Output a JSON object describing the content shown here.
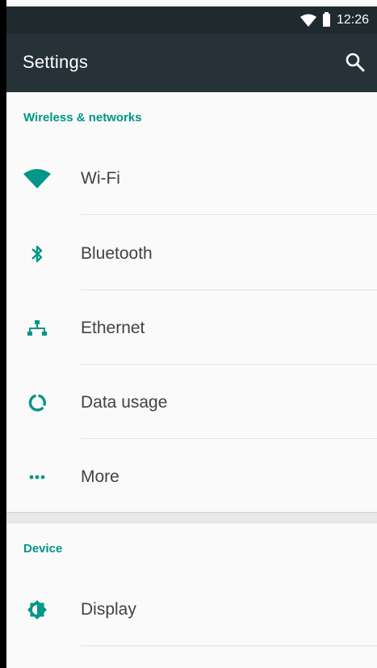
{
  "status_bar": {
    "time": "12:26"
  },
  "app_bar": {
    "title": "Settings"
  },
  "sections": [
    {
      "title": "Wireless & networks",
      "items": [
        {
          "label": "Wi-Fi",
          "icon": "wifi-icon"
        },
        {
          "label": "Bluetooth",
          "icon": "bluetooth-icon"
        },
        {
          "label": "Ethernet",
          "icon": "ethernet-icon"
        },
        {
          "label": "Data usage",
          "icon": "data-usage-icon"
        },
        {
          "label": "More",
          "icon": "more-icon"
        }
      ]
    },
    {
      "title": "Device",
      "items": [
        {
          "label": "Display",
          "icon": "display-icon"
        }
      ]
    }
  ],
  "colors": {
    "accent": "#009688",
    "app_bar": "#263238",
    "status_bar": "#1f2a2e"
  }
}
